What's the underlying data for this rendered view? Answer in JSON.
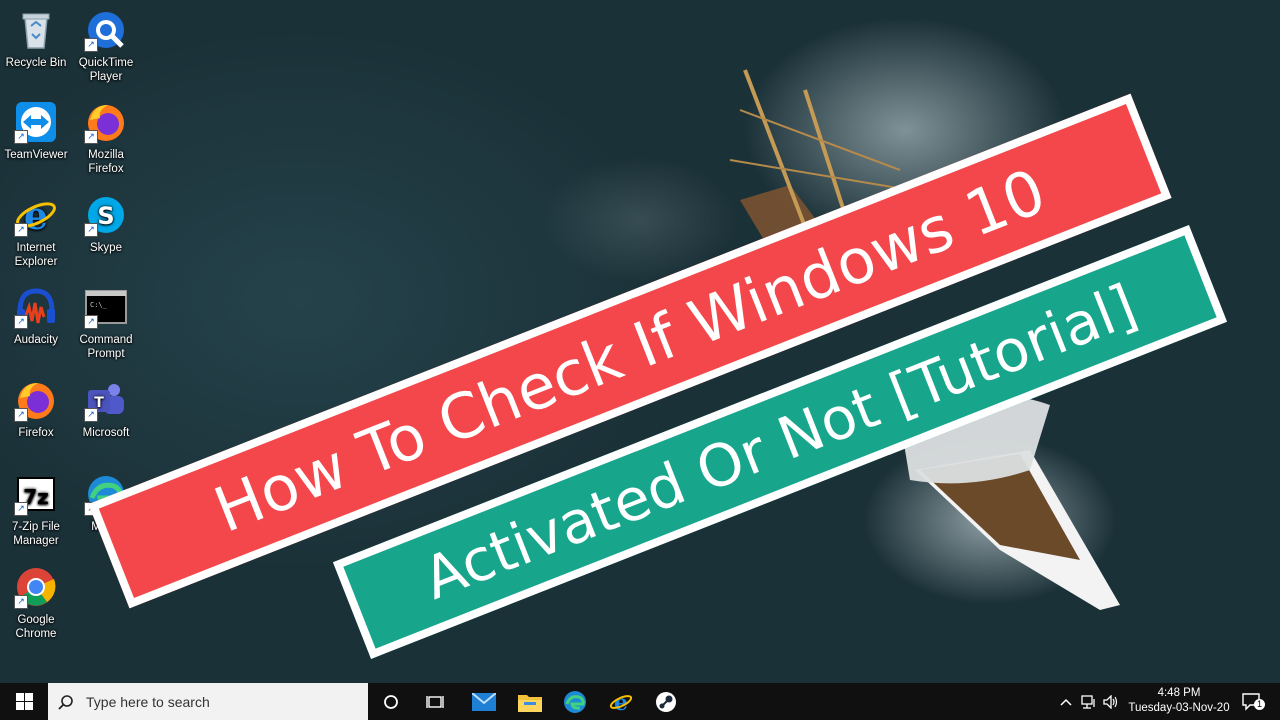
{
  "desktop_icons": [
    {
      "label": "Recycle Bin",
      "icon": "recycle-bin-icon"
    },
    {
      "label": "QuickTime Player",
      "icon": "quicktime-icon"
    },
    {
      "label": "TeamViewer",
      "icon": "teamviewer-icon"
    },
    {
      "label": "Mozilla Firefox",
      "icon": "firefox-icon"
    },
    {
      "label": "Internet Explorer",
      "icon": "internet-explorer-icon"
    },
    {
      "label": "Skype",
      "icon": "skype-icon"
    },
    {
      "label": "Audacity",
      "icon": "audacity-icon"
    },
    {
      "label": "Command Prompt",
      "icon": "command-prompt-icon"
    },
    {
      "label": "Firefox",
      "icon": "firefox-icon"
    },
    {
      "label": "Microsoft",
      "icon": "teams-icon"
    },
    {
      "label": "7-Zip File Manager",
      "icon": "7zip-icon"
    },
    {
      "label": "Mi Ed",
      "icon": "edge-icon"
    },
    {
      "label": "Google Chrome",
      "icon": "chrome-icon"
    }
  ],
  "banner": {
    "line1": "How To Check If Windows 10",
    "line2": "Activated Or Not [Tutorial]",
    "line1_color": "#f3474b",
    "line2_color": "#17a68c"
  },
  "taskbar": {
    "search_placeholder": "Type here to search",
    "time": "4:48 PM",
    "date": "Tuesday-03-Nov-20",
    "notification_count": "1",
    "cmd_text": "C:\\_"
  }
}
